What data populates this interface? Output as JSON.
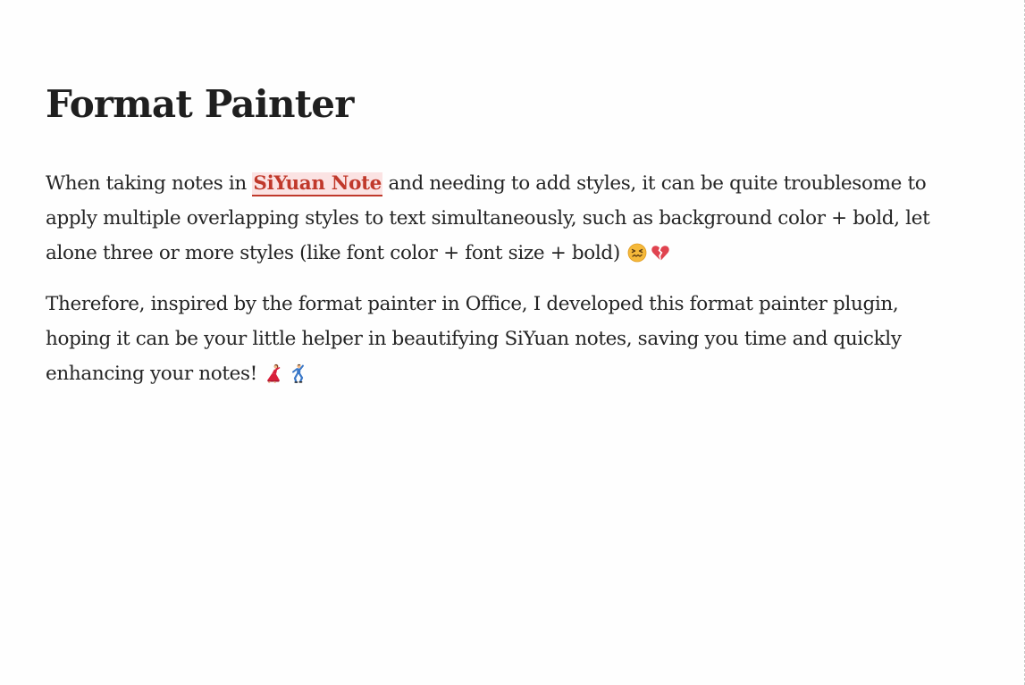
{
  "document": {
    "title": "Format Painter",
    "paragraph1": {
      "before": "When taking notes in ",
      "link": "SiYuan Note",
      "after": " and needing to add styles, it can be quite troublesome to apply multiple overlapping styles to text simultaneously, such as background color + bold, let alone three or more styles (like font color + font size + bold) ",
      "emojis": [
        "confounded-face-icon",
        "broken-heart-icon"
      ]
    },
    "paragraph2": {
      "text": "Therefore, inspired by the format painter in Office, I developed this format painter plugin, hoping it can be your little helper in beautifying SiYuan notes, saving you time and quickly enhancing your notes! ",
      "emojis": [
        "dancing-woman-icon",
        "dancing-man-icon"
      ]
    }
  },
  "colors": {
    "text": "#242424",
    "highlight_text": "#c0392b",
    "highlight_background": "#fbe3e3",
    "page_background": "#fefefe"
  }
}
